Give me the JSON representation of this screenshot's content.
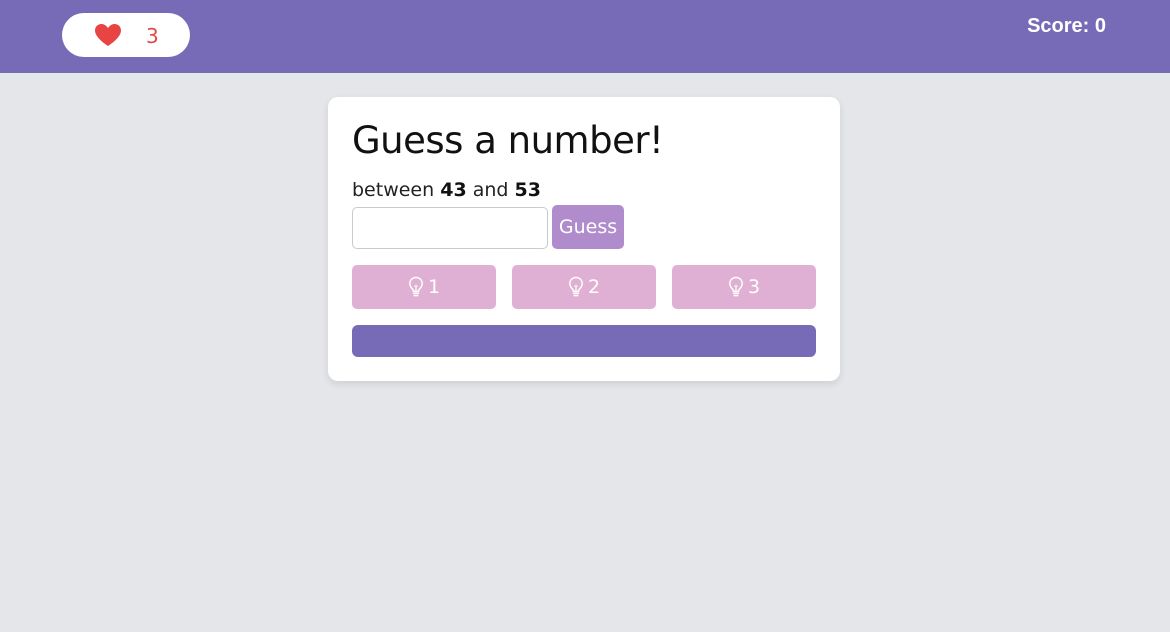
{
  "header": {
    "lives_count": "3",
    "score_text": "Score: 0",
    "lives_icon": "heart-icon"
  },
  "card": {
    "title": "Guess a number!",
    "range_prefix": "between",
    "range_min": "43",
    "range_joiner": "and",
    "range_max": "53",
    "input_value": "",
    "guess_label": "Guess",
    "hints": [
      {
        "icon": "lightbulb-icon",
        "label": "1"
      },
      {
        "icon": "lightbulb-icon",
        "label": "2"
      },
      {
        "icon": "lightbulb-icon",
        "label": "3"
      }
    ]
  },
  "colors": {
    "header_bg": "#776ab6",
    "heart": "#e84444",
    "lives_text": "#e24a4a",
    "guess_button": "#b08ccd",
    "hint_button": "#e0b0d4",
    "progress_bar": "#776ab6",
    "page_bg": "#e5e6ea"
  }
}
